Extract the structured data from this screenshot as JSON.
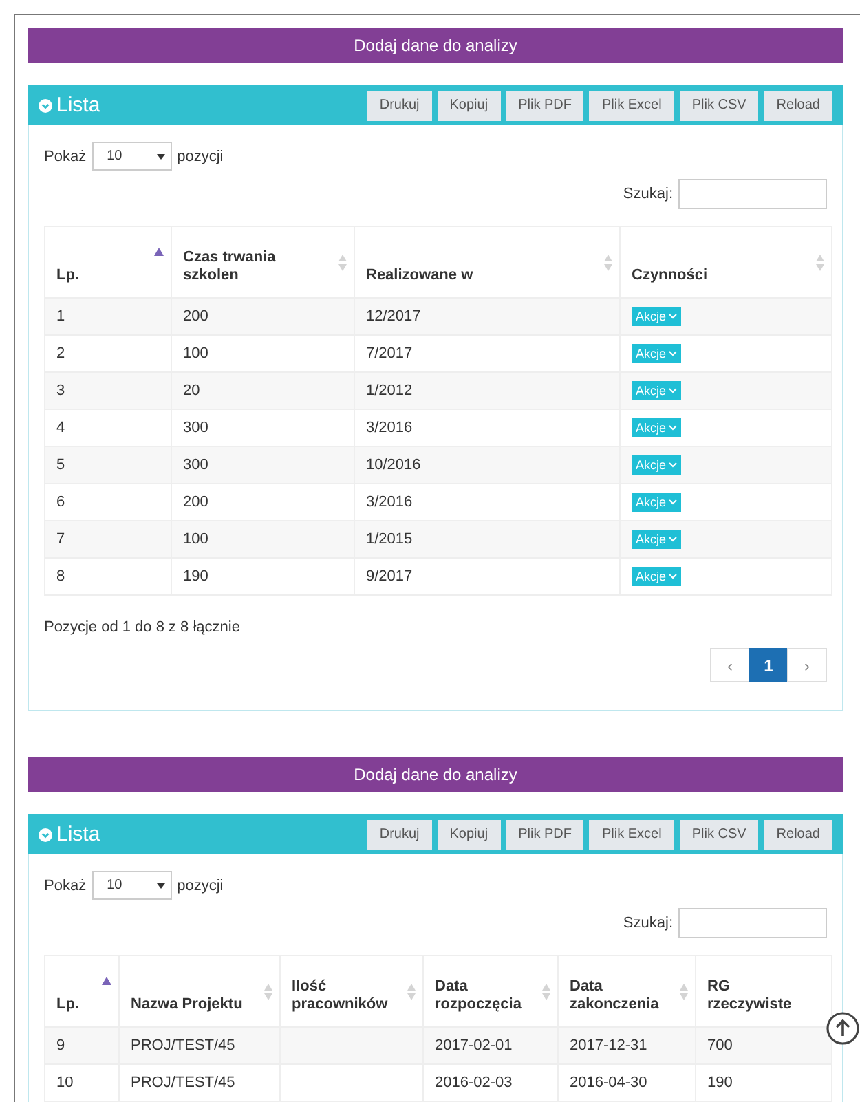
{
  "sections": [
    {
      "add_button": "Dodaj dane do analizy",
      "panel_title": "Lista",
      "toolbar": [
        "Drukuj",
        "Kopiuj",
        "Plik PDF",
        "Plik Excel",
        "Plik CSV",
        "Reload"
      ],
      "length": {
        "label_before": "Pokaż",
        "value": "10",
        "label_after": "pozycji"
      },
      "search": {
        "label": "Szukaj:"
      },
      "table": {
        "columns": [
          {
            "label": "Lp.",
            "sortable": true,
            "sorted": true
          },
          {
            "label": "Czas trwania szkolen",
            "sortable": true,
            "sorted": false
          },
          {
            "label": "Realizowane w",
            "sortable": true,
            "sorted": false
          },
          {
            "label": "Czynności",
            "sortable": true,
            "sorted": false,
            "kind": "actions"
          }
        ],
        "rows": [
          [
            "1",
            "200",
            "12/2017",
            "Akcje"
          ],
          [
            "2",
            "100",
            "7/2017",
            "Akcje"
          ],
          [
            "3",
            "20",
            "1/2012",
            "Akcje"
          ],
          [
            "4",
            "300",
            "3/2016",
            "Akcje"
          ],
          [
            "5",
            "300",
            "10/2016",
            "Akcje"
          ],
          [
            "6",
            "200",
            "3/2016",
            "Akcje"
          ],
          [
            "7",
            "100",
            "1/2015",
            "Akcje"
          ],
          [
            "8",
            "190",
            "9/2017",
            "Akcje"
          ]
        ]
      },
      "info": "Pozycje od 1 do 8 z 8 łącznie",
      "pagination": {
        "prev": "‹",
        "pages": [
          {
            "label": "1",
            "selected": true
          }
        ],
        "next": "›"
      }
    },
    {
      "add_button": "Dodaj dane do analizy",
      "panel_title": "Lista",
      "toolbar": [
        "Drukuj",
        "Kopiuj",
        "Plik PDF",
        "Plik Excel",
        "Plik CSV",
        "Reload"
      ],
      "length": {
        "label_before": "Pokaż",
        "value": "10",
        "label_after": "pozycji"
      },
      "search": {
        "label": "Szukaj:"
      },
      "table": {
        "columns": [
          {
            "label": "Lp.",
            "sortable": true,
            "sorted": true
          },
          {
            "label": "Nazwa Projektu",
            "sortable": true,
            "sorted": false
          },
          {
            "label": "Ilość pracowników",
            "sortable": true,
            "sorted": false
          },
          {
            "label": "Data rozpoczęcia",
            "sortable": true,
            "sorted": false
          },
          {
            "label": "Data zakonczenia",
            "sortable": true,
            "sorted": false
          },
          {
            "label": "RG rzeczywiste"
          }
        ],
        "rows": [
          [
            "9",
            "PROJ/TEST/45",
            null,
            "2017-02-01",
            "2017-12-31",
            "700"
          ],
          [
            "10",
            "PROJ/TEST/45",
            null,
            "2016-02-03",
            "2016-04-30",
            "190"
          ]
        ]
      }
    }
  ]
}
